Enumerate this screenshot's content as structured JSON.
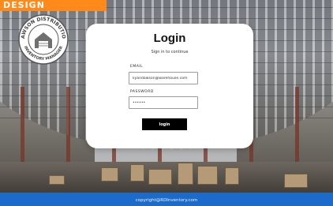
{
  "banner": {
    "text": "DESIGN",
    "color": "#ff8a1c"
  },
  "logo": {
    "icon": "warehouse-icon",
    "text_top": "DAWSON DISTRIBUTION",
    "text_bottom": "INVENTORY MANAGER"
  },
  "login": {
    "title": "Login",
    "subtitle": "Sign in to continue",
    "email_label": "EMAIL",
    "email_value": "liyandawson@warehouse.com",
    "password_label": "PASSWORD",
    "password_value": "••••••",
    "button_label": "login"
  },
  "footer": {
    "text": "copyright@RDInventory.com",
    "color": "#1c6ac9"
  }
}
